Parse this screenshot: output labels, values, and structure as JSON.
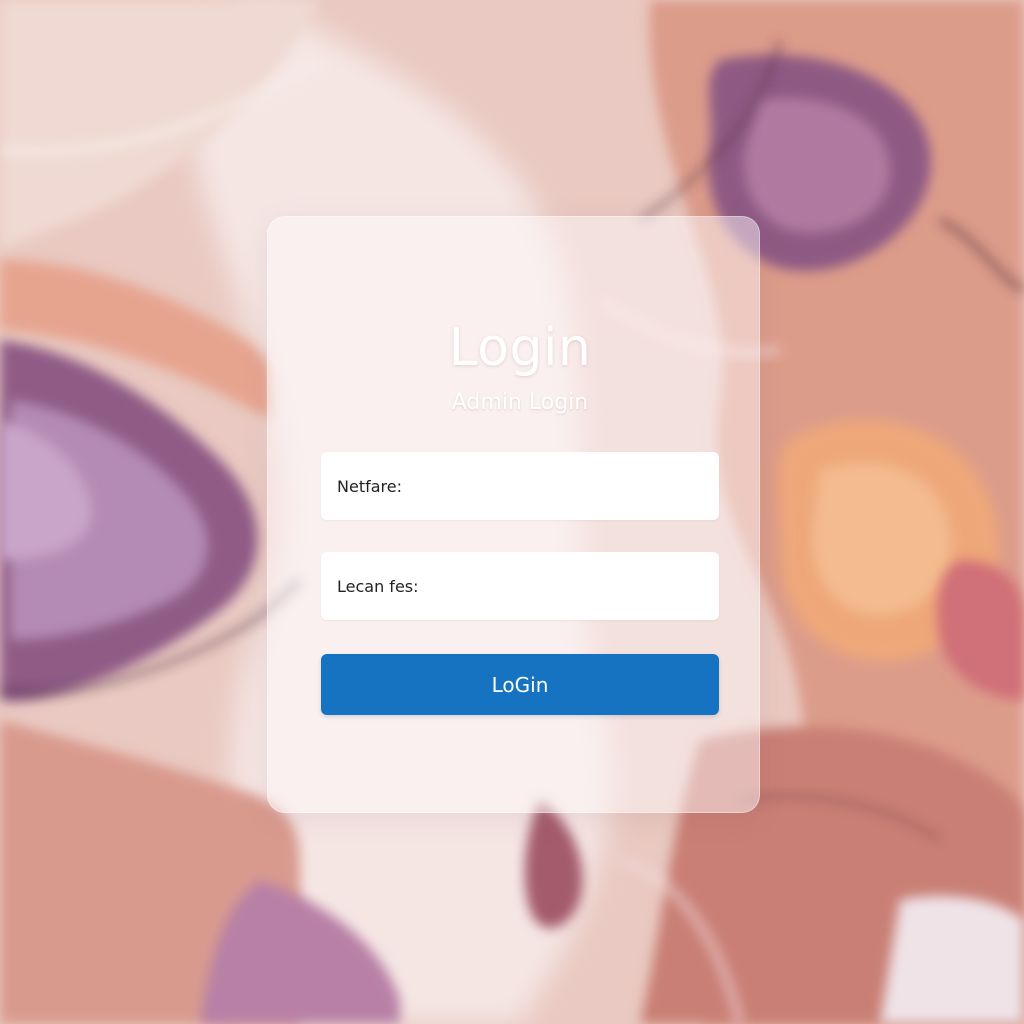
{
  "colors": {
    "accent": "#1573c2",
    "card_bg": "rgba(255,250,252,0.48)",
    "field_bg": "#ffffff",
    "text_dark": "#222222",
    "title_text": "#ffffff"
  },
  "background": {
    "description_icon": "marble-background"
  },
  "card": {
    "title": "Login",
    "subtitle": "Admin Login"
  },
  "form": {
    "username_label": "Netfare:",
    "username_value": "",
    "password_label": "Lecan fes:",
    "password_value": "",
    "submit_label": "LoGin"
  }
}
